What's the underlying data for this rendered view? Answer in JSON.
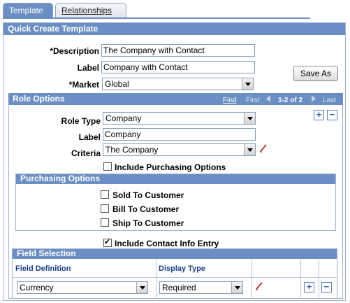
{
  "tabs": [
    {
      "label": "Template",
      "active": true
    },
    {
      "label": "Relationships",
      "active": false
    }
  ],
  "quick_create": {
    "header": "Quick Create Template",
    "description_label": "*Description",
    "description_value": "The Company with Contact",
    "label_label": "Label",
    "label_value": "Company with Contact",
    "market_label": "*Market",
    "market_value": "Global",
    "save_as_label": "Save As"
  },
  "role_options": {
    "header": "Role Options",
    "nav": {
      "find": "Find",
      "first": "First",
      "range": "1-2 of 2",
      "last": "Last"
    },
    "role_type_label": "Role Type",
    "role_type_value": "Company",
    "label_label": "Label",
    "label_value": "Company",
    "criteria_label": "Criteria",
    "criteria_value": "The Company",
    "include_purchasing_label": "Include Purchasing Options",
    "include_purchasing_checked": false
  },
  "purchasing_options": {
    "header": "Purchasing Options",
    "items": [
      {
        "label": "Sold To Customer",
        "checked": false
      },
      {
        "label": "Bill To Customer",
        "checked": false
      },
      {
        "label": "Ship To Customer",
        "checked": false
      }
    ]
  },
  "include_contact": {
    "label": "Include Contact Info Entry",
    "checked": true
  },
  "field_selection": {
    "header": "Field Selection",
    "columns": [
      "Field Definition",
      "Display Type"
    ],
    "rows": [
      {
        "field_definition": "Currency",
        "display_type": "Required"
      }
    ]
  },
  "icons": {
    "add": "+",
    "remove": "−"
  },
  "colors": {
    "header_bg": "#6b8ec4",
    "border": "#9fb2cf",
    "link_blue": "#1a3f8a"
  }
}
